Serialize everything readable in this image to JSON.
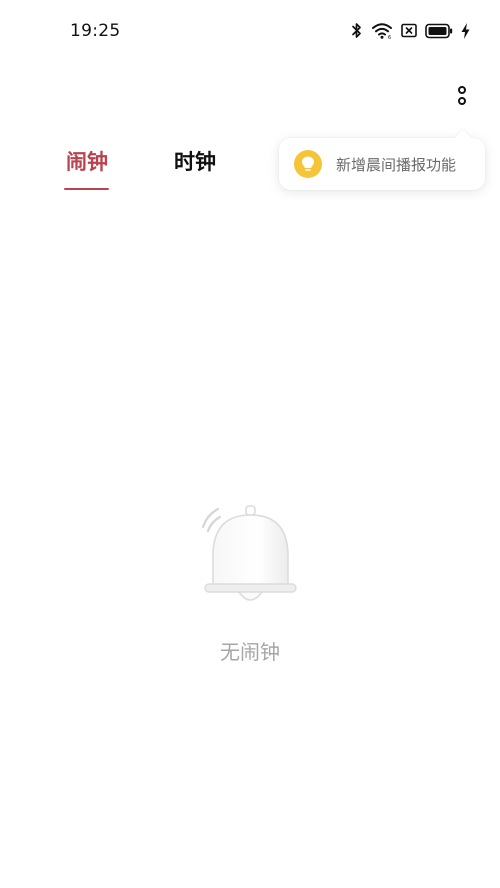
{
  "status_bar": {
    "time": "19:25",
    "icons": [
      "bluetooth-icon",
      "wifi-icon",
      "sim-off-icon",
      "battery-icon",
      "charging-icon"
    ]
  },
  "toolbar": {
    "more_icon": "more-vertical-icon"
  },
  "tabs": [
    {
      "label": "闹钟",
      "active": true
    },
    {
      "label": "时钟",
      "active": false
    }
  ],
  "tooltip": {
    "icon": "lightbulb-icon",
    "text": "新增晨间播报功能"
  },
  "empty_state": {
    "icon": "bell-icon",
    "text": "无闹钟"
  },
  "colors": {
    "accent": "#b9444f",
    "tooltip_icon_bg": "#f5c437",
    "muted_text": "#a6a6a6"
  }
}
